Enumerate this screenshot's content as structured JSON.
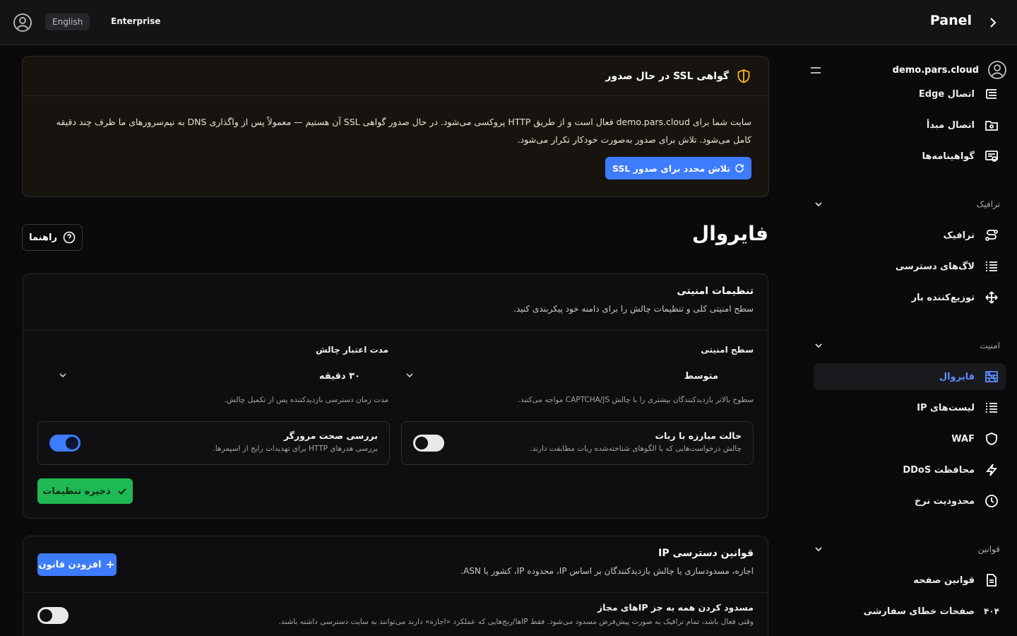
{
  "topbar": {
    "language": "English",
    "edition": "Enterprise",
    "panel_title": "Panel"
  },
  "sidebar": {
    "domain": "demo.pars.cloud",
    "items_top": [
      {
        "label": "اتصال Edge",
        "icon": "edge-connection-icon"
      },
      {
        "label": "اتصال مبدأ",
        "icon": "origin-folder-icon"
      },
      {
        "label": "گواهینامه‌ها",
        "icon": "certificate-icon"
      }
    ],
    "section_traffic": "ترافیک",
    "items_traffic": [
      {
        "label": "ترافیک",
        "icon": "traffic-route-icon"
      },
      {
        "label": "لاگ‌های دسترسی",
        "icon": "list-icon"
      },
      {
        "label": "توزیع‌کننده بار",
        "icon": "load-balancer-icon"
      }
    ],
    "section_security": "امنیت",
    "items_security": [
      {
        "label": "فایروال",
        "icon": "firewall-icon",
        "active": true
      },
      {
        "label": "لیست‌های IP",
        "icon": "list-icon"
      },
      {
        "label": "WAF",
        "icon": "shield-icon"
      },
      {
        "label": "محافظت DDoS",
        "icon": "lightning-icon"
      },
      {
        "label": "محدودیت نرخ",
        "icon": "clock-icon"
      }
    ],
    "section_rules": "قوانین",
    "items_rules": [
      {
        "label": "قوانین صفحه",
        "icon": "document-icon"
      },
      {
        "label": "صفحات خطای سفارشی",
        "icon": "error-404-icon",
        "badge": "۴۰۴"
      }
    ]
  },
  "ssl_banner": {
    "title": "گواهی SSL در حال صدور",
    "line1": "سایت شما برای demo.pars.cloud فعال است و از طریق HTTP پروکسی می‌شود. در حال صدور گواهی SSL آن هستیم — معمولاً پس از واگذاری DNS به نیم‌سرورهای ما ظرف چند دقیقه",
    "line2": "کامل می‌شود. تلاش برای صدور به‌صورت خودکار تکرار می‌شود.",
    "retry_label": "تلاش مجدد برای صدور SSL"
  },
  "page": {
    "title": "فایروال",
    "help_label": "راهنما"
  },
  "security_settings": {
    "title": "تنظیمات امنیتی",
    "subtitle": "سطح امنیتی کلی و تنظیمات چالش را برای دامنه خود پیکربندی کنید.",
    "level_label": "سطح امنیتی",
    "level_value": "متوسط",
    "level_hint": "سطوح بالاتر بازدیدکنندگان بیشتری را با چالش CAPTCHA/JS مواجه می‌کنند.",
    "ttl_label": "مدت اعتبار چالش",
    "ttl_value": "۳۰ دقیقه",
    "ttl_hint": "مدت زمان دسترسی بازدیدکننده پس از تکمیل چالش.",
    "bot_title": "حالت مبارزه با ربات",
    "bot_desc": "چالش درخواست‌هایی که با الگوهای شناخته‌شده ربات مطابقت دارند.",
    "bot_enabled": false,
    "browser_title": "بررسی صحت مرورگر",
    "browser_desc": "بررسی هدرهای HTTP برای تهدیدات رایج از اسپمرها.",
    "browser_enabled": true,
    "save_label": "ذخیره تنظیمات"
  },
  "ip_rules": {
    "title": "قوانین دسترسی IP",
    "subtitle": "اجازه، مسدودسازی یا چالش بازدیدکنندگان بر اساس IP، محدوده IP، کشور یا ASN.",
    "add_label": "افزودن قانون",
    "block_title": "مسدود کردن همه به جز IPهای مجاز",
    "block_desc": "وقتی فعال باشد، تمام ترافیک به صورت پیش‌فرض مسدود می‌شود. فقط IPها/رنج‌هایی که عملکرد «اجازه» دارند می‌توانند به سایت دسترسی داشته باشند.",
    "block_enabled": false
  },
  "colors": {
    "accent": "#3d7bff",
    "success": "#1fb954",
    "warning": "#f5b324"
  }
}
